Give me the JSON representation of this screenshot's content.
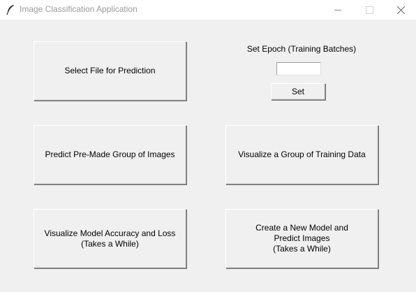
{
  "window": {
    "title": "Image Classification Application",
    "icon": "feather-icon",
    "controls": [
      "minimize-icon",
      "maximize-icon",
      "close-icon"
    ]
  },
  "main": {
    "select_file_label": "Select File for Prediction",
    "epoch": {
      "label": "Set Epoch (Training Batches)",
      "value": "",
      "set_label": "Set"
    },
    "predict_group_label": "Predict Pre-Made Group of Images",
    "visualize_training_label": "Visualize a Group of Training Data",
    "visualize_accuracy_label": "Visualize Model Accuracy and Loss\n(Takes a While)",
    "create_model_label": "Create a New Model and\nPredict Images\n(Takes a While)"
  },
  "colors": {
    "background": "#f0f0f0",
    "titlebar": "#ffffff",
    "title_text": "#9a9a9a"
  }
}
